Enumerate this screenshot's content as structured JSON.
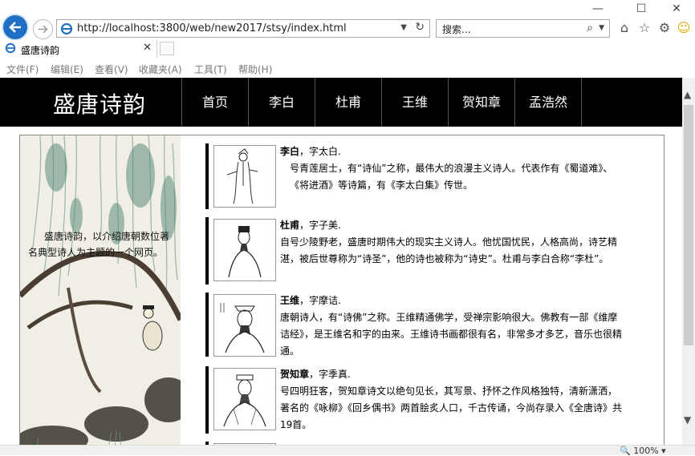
{
  "browser": {
    "url": "http://localhost:3800/web/new2017/stsy/index.html",
    "search_placeholder": "搜索...",
    "tab_title": "盛唐诗韵",
    "menu": [
      "文件(F)",
      "编辑(E)",
      "查看(V)",
      "收藏夹(A)",
      "工具(T)",
      "帮助(H)"
    ],
    "zoom": "100%"
  },
  "site": {
    "logo": "盛唐诗韵",
    "nav": [
      "首页",
      "李白",
      "杜甫",
      "王维",
      "贺知章",
      "孟浩然"
    ],
    "intro": "盛唐诗韵，以介绍唐朝数位著名典型诗人为主题的一个网页。"
  },
  "poets": [
    {
      "name": "李白",
      "courtesy": "，字太白.",
      "desc": "号青莲居士，有“诗仙”之称，最伟大的浪漫主义诗人。代表作有《蜀道难》、《将进酒》等诗篇，有《李太白集》传世。"
    },
    {
      "name": "杜甫",
      "courtesy": "，字子美.",
      "desc": "自号少陵野老，盛唐时期伟大的现实主义诗人。他忧国忧民，人格高尚，诗艺精湛，被后世尊称为“诗圣”，他的诗也被称为“诗史”。杜甫与李白合称“李杜”。"
    },
    {
      "name": "王维",
      "courtesy": "，字摩诘.",
      "desc": "唐朝诗人，有“诗佛”之称。王维精通佛学，受禅宗影响很大。佛教有一部《维摩诘经》，是王维名和字的由来。王维诗书画都很有名，非常多才多艺，音乐也很精通。"
    },
    {
      "name": "贺知章",
      "courtesy": "，字季真.",
      "desc": "号四明狂客，贺知章诗文以绝句见长，其写景、抒怀之作风格独特，清新潇洒，著名的《咏柳》《回乡偶书》两首脍炙人口，千古传诵，今尚存录入《全唐诗》共19首。"
    }
  ]
}
